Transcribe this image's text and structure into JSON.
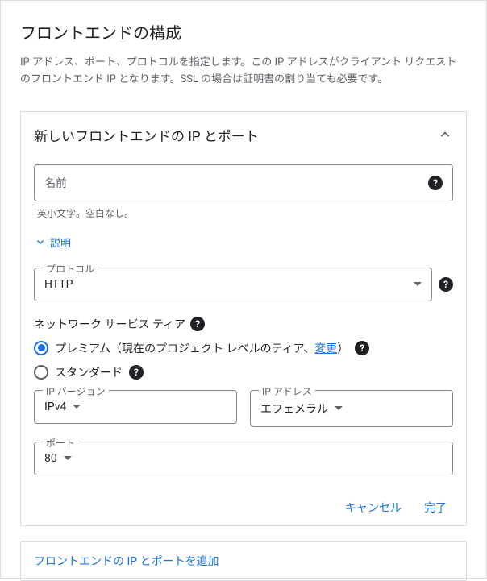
{
  "page": {
    "title": "フロントエンドの構成",
    "description": "IP アドレス、ポート、プロトコルを指定します。この IP アドレスがクライアント リクエストのフロントエンド IP となります。SSL の場合は証明書の割り当ても必要です。"
  },
  "card": {
    "title": "新しいフロントエンドの IP とポート",
    "name_placeholder": "名前",
    "name_helper": "英小文字。空白なし。",
    "desc_toggle": "説明",
    "protocol_label": "プロトコル",
    "protocol_value": "HTTP",
    "tier_label": "ネットワーク サービス ティア",
    "tier_premium_prefix": "プレミアム（現在のプロジェクト レベルのティア、",
    "tier_premium_link": "変更",
    "tier_premium_suffix": "）",
    "tier_standard": "スタンダード",
    "ip_version_label": "IP バージョン",
    "ip_version_value": "IPv4",
    "ip_address_label": "IP アドレス",
    "ip_address_value": "エフェメラル",
    "port_label": "ポート",
    "port_value": "80",
    "cancel": "キャンセル",
    "done": "完了"
  },
  "add_link": "フロントエンドの IP とポートを追加"
}
